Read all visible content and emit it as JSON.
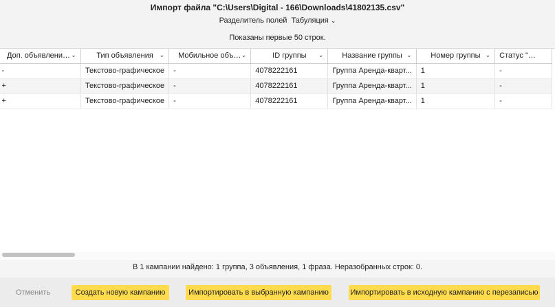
{
  "dialog": {
    "title": "Импорт файла \"C:\\Users\\Digital - 166\\Downloads\\41802135.csv\"",
    "separator_label": "Разделитель полей",
    "separator_value": "Табуляция",
    "shown_rows_text": "Показаны первые 50 строк."
  },
  "table": {
    "columns": [
      "Доп. объявление...",
      "Тип объявления",
      "Мобильное объя...",
      "ID группы",
      "Название группы",
      "Номер группы",
      "Статус \"Мало"
    ],
    "rows": [
      [
        "-",
        "Текстово-графическое",
        "-",
        "4078222161",
        "Группа Аренда-кварт...",
        "1",
        "-"
      ],
      [
        "+",
        "Текстово-графическое",
        "-",
        "4078222161",
        "Группа Аренда-кварт...",
        "1",
        "-"
      ],
      [
        "+",
        "Текстово-графическое",
        "-",
        "4078222161",
        "Группа Аренда-кварт...",
        "1",
        "-"
      ]
    ]
  },
  "summary_text": "В 1 кампании найдено: 1 группа, 3 объявления, 1 фраза. Неразобранных строк: 0.",
  "footer": {
    "cancel_label": "Отменить",
    "create_label": "Создать новую кампанию",
    "import_selected_label": "Импортировать в выбранную кампанию",
    "import_original_label": "Импортировать в исходную кампанию с перезаписью"
  },
  "colors": {
    "button_yellow": "#ffdb4d",
    "panel_gray": "#f3f3f3"
  }
}
